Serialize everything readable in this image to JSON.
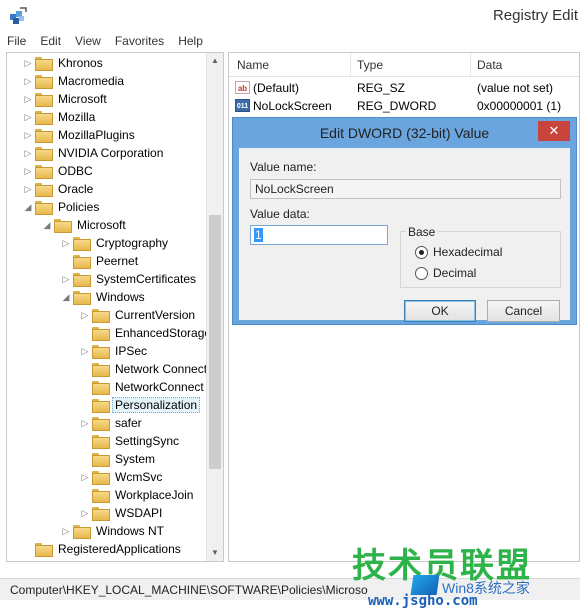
{
  "window": {
    "title": "Registry Edit"
  },
  "menu": [
    "File",
    "Edit",
    "View",
    "Favorites",
    "Help"
  ],
  "tree": [
    {
      "label": "Khronos",
      "depth": 0,
      "arrow": "▷"
    },
    {
      "label": "Macromedia",
      "depth": 0,
      "arrow": "▷"
    },
    {
      "label": "Microsoft",
      "depth": 0,
      "arrow": "▷"
    },
    {
      "label": "Mozilla",
      "depth": 0,
      "arrow": "▷"
    },
    {
      "label": "MozillaPlugins",
      "depth": 0,
      "arrow": "▷"
    },
    {
      "label": "NVIDIA Corporation",
      "depth": 0,
      "arrow": "▷"
    },
    {
      "label": "ODBC",
      "depth": 0,
      "arrow": "▷"
    },
    {
      "label": "Oracle",
      "depth": 0,
      "arrow": "▷"
    },
    {
      "label": "Policies",
      "depth": 0,
      "arrow": "◢"
    },
    {
      "label": "Microsoft",
      "depth": 1,
      "arrow": "◢"
    },
    {
      "label": "Cryptography",
      "depth": 2,
      "arrow": "▷"
    },
    {
      "label": "Peernet",
      "depth": 2,
      "arrow": ""
    },
    {
      "label": "SystemCertificates",
      "depth": 2,
      "arrow": "▷"
    },
    {
      "label": "Windows",
      "depth": 2,
      "arrow": "◢"
    },
    {
      "label": "CurrentVersion",
      "depth": 3,
      "arrow": "▷"
    },
    {
      "label": "EnhancedStorage",
      "depth": 3,
      "arrow": ""
    },
    {
      "label": "IPSec",
      "depth": 3,
      "arrow": "▷"
    },
    {
      "label": "Network Connect",
      "depth": 3,
      "arrow": ""
    },
    {
      "label": "NetworkConnect",
      "depth": 3,
      "arrow": ""
    },
    {
      "label": "Personalization",
      "depth": 3,
      "arrow": "",
      "selected": true
    },
    {
      "label": "safer",
      "depth": 3,
      "arrow": "▷"
    },
    {
      "label": "SettingSync",
      "depth": 3,
      "arrow": ""
    },
    {
      "label": "System",
      "depth": 3,
      "arrow": ""
    },
    {
      "label": "WcmSvc",
      "depth": 3,
      "arrow": "▷"
    },
    {
      "label": "WorkplaceJoin",
      "depth": 3,
      "arrow": ""
    },
    {
      "label": "WSDAPI",
      "depth": 3,
      "arrow": "▷"
    },
    {
      "label": "Windows NT",
      "depth": 2,
      "arrow": "▷"
    },
    {
      "label": "RegisteredApplications",
      "depth": 0,
      "arrow": ""
    }
  ],
  "list": {
    "columns": [
      "Name",
      "Type",
      "Data"
    ],
    "rows": [
      {
        "icon": "string-value-icon",
        "icon_text": "ab",
        "name": "(Default)",
        "type": "REG_SZ",
        "data": "(value not set)"
      },
      {
        "icon": "dword-value-icon",
        "icon_text": "011",
        "name": "NoLockScreen",
        "type": "REG_DWORD",
        "data": "0x00000001 (1)"
      }
    ]
  },
  "dialog": {
    "title": "Edit DWORD (32-bit) Value",
    "close_label": "✕",
    "value_name_label": "Value name:",
    "value_name": "NoLockScreen",
    "value_data_label": "Value data:",
    "value_data": "1",
    "base_label": "Base",
    "radio_hex": "Hexadecimal",
    "radio_dec": "Decimal",
    "base_selected": "Hexadecimal",
    "ok": "OK",
    "cancel": "Cancel"
  },
  "status": "Computer\\HKEY_LOCAL_MACHINE\\SOFTWARE\\Policies\\Microso",
  "watermark": {
    "main": "技术员联盟",
    "sub": "Win8系统之家",
    "url": "www.jsgho.com"
  }
}
